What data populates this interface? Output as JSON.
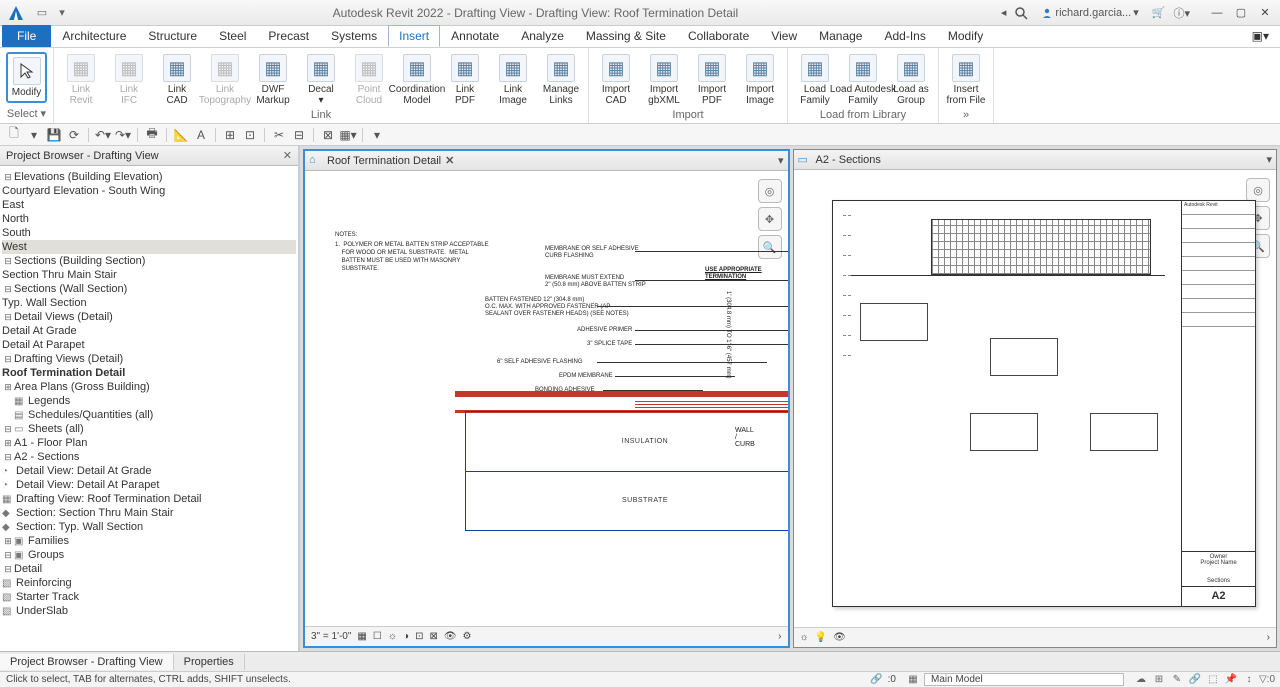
{
  "titlebar": {
    "app_title": "Autodesk Revit 2022 - Drafting View - Drafting View: Roof Termination Detail",
    "user": "richard.garcia...",
    "search_icon_aria": "Search"
  },
  "menutabs": {
    "file": "File",
    "tabs": [
      "Architecture",
      "Structure",
      "Steel",
      "Precast",
      "Systems",
      "Insert",
      "Annotate",
      "Analyze",
      "Massing & Site",
      "Collaborate",
      "View",
      "Manage",
      "Add-Ins",
      "Modify"
    ],
    "active": "Insert"
  },
  "ribbon": {
    "select_label": "Select ▾",
    "modify": "Modify",
    "groups": {
      "link": {
        "label": "Link",
        "items": [
          {
            "id": "link-revit",
            "label": "Link\nRevit",
            "disabled": true
          },
          {
            "id": "link-ifc",
            "label": "Link\nIFC",
            "disabled": true
          },
          {
            "id": "link-cad",
            "label": "Link\nCAD"
          },
          {
            "id": "link-topo",
            "label": "Link\nTopography",
            "disabled": true
          },
          {
            "id": "dwf-markup",
            "label": "DWF\nMarkup"
          },
          {
            "id": "decal",
            "label": "Decal\n▾"
          },
          {
            "id": "point-cloud",
            "label": "Point\nCloud",
            "disabled": true
          },
          {
            "id": "coord-model",
            "label": "Coordination\nModel"
          },
          {
            "id": "link-pdf",
            "label": "Link\nPDF"
          },
          {
            "id": "link-image",
            "label": "Link\nImage"
          },
          {
            "id": "manage-links",
            "label": "Manage\nLinks"
          }
        ]
      },
      "import": {
        "label": "Import",
        "items": [
          {
            "id": "import-cad",
            "label": "Import\nCAD"
          },
          {
            "id": "import-gbxml",
            "label": "Import\ngbXML"
          },
          {
            "id": "import-pdf",
            "label": "Import\nPDF"
          },
          {
            "id": "import-image",
            "label": "Import\nImage"
          }
        ]
      },
      "library": {
        "label": "Load from Library",
        "items": [
          {
            "id": "load-family",
            "label": "Load\nFamily"
          },
          {
            "id": "load-autodesk",
            "label": "Load Autodesk\nFamily"
          },
          {
            "id": "load-group",
            "label": "Load as\nGroup"
          }
        ]
      },
      "insertfile": {
        "label": "»",
        "items": [
          {
            "id": "insert-from-file",
            "label": "Insert\nfrom File"
          }
        ]
      }
    }
  },
  "browser": {
    "title": "Project Browser - Drafting View",
    "tree": {
      "elevations_hdr": "Elevations (Building Elevation)",
      "elev_items": [
        "Courtyard Elevation - South Wing",
        "East",
        "North",
        "South",
        "West"
      ],
      "sections_bld": "Sections (Building Section)",
      "section_main_stair": "Section Thru Main Stair",
      "sections_wall": "Sections (Wall Section)",
      "typ_wall": "Typ. Wall Section",
      "detail_views": "Detail Views (Detail)",
      "detail_grade": "Detail At Grade",
      "detail_parapet": "Detail At Parapet",
      "drafting_views": "Drafting Views (Detail)",
      "roof_term": "Roof Termination Detail",
      "area_plans": "Area Plans (Gross Building)",
      "legends": "Legends",
      "schedules": "Schedules/Quantities (all)",
      "sheets": "Sheets (all)",
      "a1": "A1 - Floor Plan",
      "a2": "A2 - Sections",
      "a2_items": [
        "Detail View: Detail At Grade",
        "Detail View: Detail At Parapet",
        "Drafting View: Roof Termination Detail",
        "Section: Section Thru Main Stair",
        "Section: Typ. Wall Section"
      ],
      "families": "Families",
      "groups": "Groups",
      "detail_grp": "Detail",
      "detail_grp_items": [
        "Reinforcing",
        "Starter Track",
        "UnderSlab"
      ]
    }
  },
  "view_left": {
    "title": "Roof Termination Detail",
    "scale": "3\" = 1'-0\"",
    "notes_header": "NOTES:",
    "notes_body": "1.  POLYMER OR METAL BATTEN STRIP ACCEPTABLE\n    FOR WOOD OR METAL SUBSTRATE.  METAL\n    BATTEN MUST BE USED WITH MASONRY\n    SUBSTRATE.",
    "callouts": {
      "c1": "MEMBRANE OR SELF ADHESIVE\nCURB FLASHING",
      "c2": "MEMBRANE MUST EXTEND\n2\" (50.8 mm) ABOVE BATTEN STRIP",
      "c3": "BATTEN FASTENED 12\" (304.8 mm)\nO.C. MAX. WITH APPROVED FASTENER (AP\nSEALANT OVER FASTENER HEADS) (SEE NOTES)",
      "c4": "ADHESIVE PRIMER",
      "c5": "3\" SPLICE TAPE",
      "c6": "6\" SELF ADHESIVE FLASHING",
      "c7": "EPDM MEMBRANE",
      "c8": "BONDING ADHESIVE",
      "term": "USE APPROPRIATE\nTERMINATION",
      "dim": "1' (304.8 mm) TO 1'-6\" (457 mm)",
      "wall": "WALL / CURB",
      "insulation": "INSULATION",
      "substrate": "SUBSTRATE"
    }
  },
  "view_right": {
    "title": "A2 - Sections",
    "sheet": {
      "logo": "Autodesk Revit",
      "owner": "Owner",
      "project": "Project Name",
      "sheetname": "Sections",
      "number": "A2"
    }
  },
  "proptabs": {
    "browser": "Project Browser - Drafting View",
    "properties": "Properties"
  },
  "status": {
    "hint": "Click to select, TAB for alternates, CTRL adds, SHIFT unselects.",
    "selcount": ":0",
    "model": "Main Model"
  }
}
